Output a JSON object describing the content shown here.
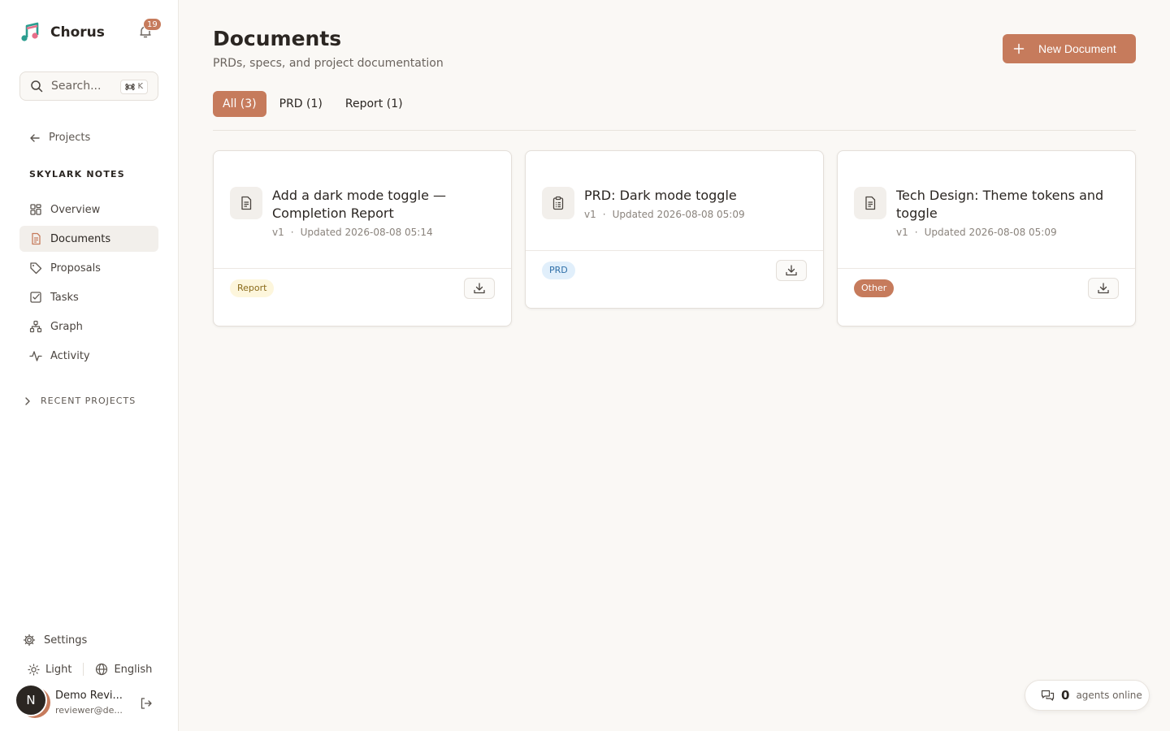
{
  "app": {
    "name": "Chorus",
    "notification_count": "19"
  },
  "search": {
    "placeholder": "Search...",
    "shortcut": "K"
  },
  "nav": {
    "back_label": "Projects",
    "project_name": "SKYLARK NOTES",
    "items": [
      {
        "label": "Overview",
        "icon": "grid-icon"
      },
      {
        "label": "Documents",
        "icon": "document-icon",
        "active": true
      },
      {
        "label": "Proposals",
        "icon": "tag-icon"
      },
      {
        "label": "Tasks",
        "icon": "checkbox-icon"
      },
      {
        "label": "Graph",
        "icon": "graph-icon"
      },
      {
        "label": "Activity",
        "icon": "activity-icon"
      }
    ],
    "recent_label": "RECENT PROJECTS"
  },
  "footer": {
    "settings_label": "Settings",
    "theme_label": "Light",
    "language_label": "English",
    "user_initial": "N",
    "user_name": "Demo Revi...",
    "user_email": "reviewer@de..."
  },
  "page": {
    "title": "Documents",
    "subtitle": "PRDs, specs, and project documentation",
    "new_button": "New Document"
  },
  "tabs": [
    {
      "label": "All (3)",
      "active": true
    },
    {
      "label": "PRD (1)"
    },
    {
      "label": "Report (1)"
    }
  ],
  "documents": [
    {
      "title": "Add a dark mode toggle — Completion Report",
      "version": "v1",
      "updated": "Updated 2026-08-08 05:14",
      "badge": "Report",
      "badge_color": "#fdf6dc",
      "badge_text_color": "#8a6a1a"
    },
    {
      "title": "PRD: Dark mode toggle",
      "version": "v1",
      "updated": "Updated 2026-08-08 05:09",
      "badge": "PRD",
      "badge_color": "#e1effb",
      "badge_text_color": "#2f6fa8"
    },
    {
      "title": "Tech Design: Theme tokens and toggle",
      "version": "v1",
      "updated": "Updated 2026-08-08 05:09",
      "badge": "Other",
      "badge_color": "#c67b5c",
      "badge_text_color": "#ffffff"
    }
  ],
  "status": {
    "agents_count": "0",
    "agents_label": "agents online"
  },
  "colors": {
    "accent": "#c67b5c",
    "background": "#faf8f5"
  }
}
